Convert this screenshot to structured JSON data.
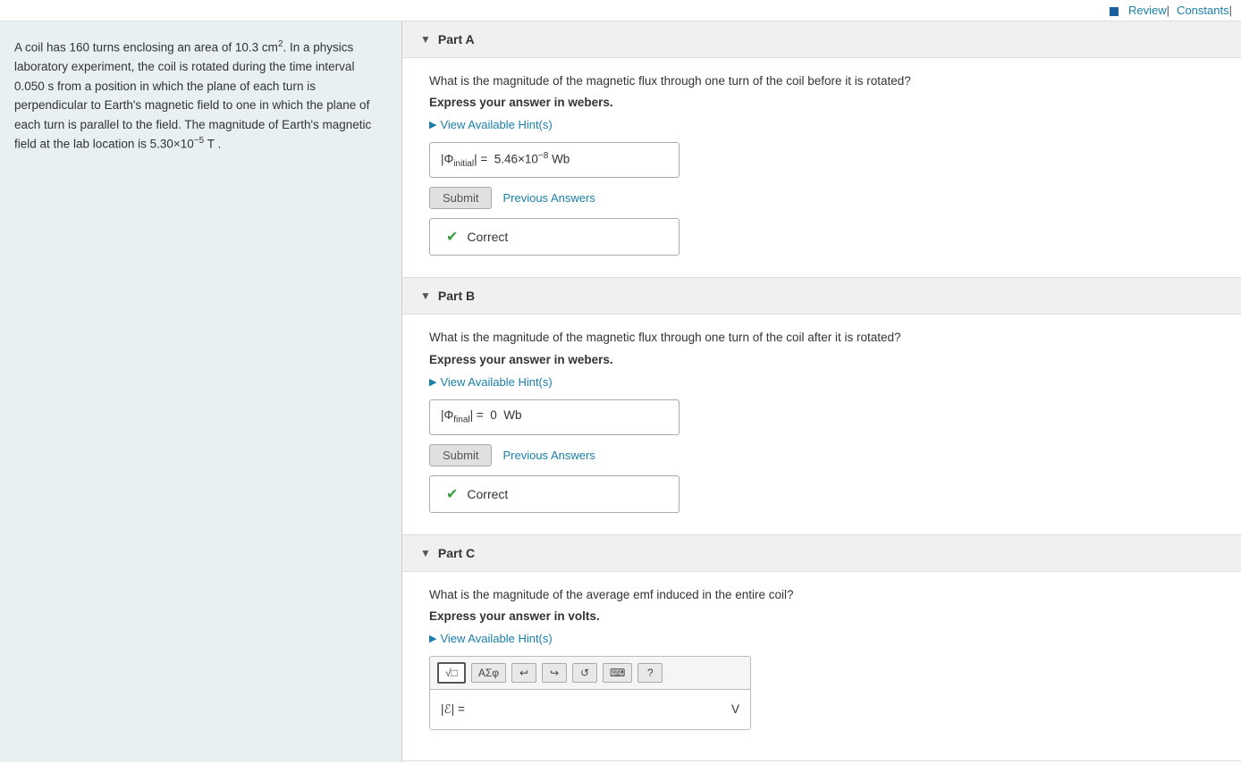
{
  "topbar": {
    "review_label": "Review",
    "constants_label": "Constants",
    "separator": "|"
  },
  "sidebar": {
    "problem_text": "A coil has 160 turns enclosing an area of 10.3 cm",
    "area_exp": "2",
    "problem_text2": ". In a physics laboratory experiment, the coil is rotated during the time interval 0.050 s  from a position in which the plane of each turn is perpendicular to Earth's magnetic field to one in which the plane of each turn is parallel to the field. The magnitude of Earth's magnetic field at the lab location is 5.30×10",
    "field_exp": "−5",
    "field_unit": "T"
  },
  "partA": {
    "label": "Part A",
    "question": "What is the magnitude of the magnetic flux through one turn of the coil before it is rotated?",
    "express": "Express your answer in webers.",
    "hint_label": "View Available Hint(s)",
    "answer_prefix": "|Φ",
    "answer_sub": "initial",
    "answer_suffix": "| =  5.46×10",
    "answer_exp": "−8",
    "answer_unit": " Wb",
    "submit_label": "Submit",
    "prev_answers_label": "Previous Answers",
    "correct_label": "Correct"
  },
  "partB": {
    "label": "Part B",
    "question": "What is the magnitude  of the magnetic flux through one turn of the coil after it is rotated?",
    "express": "Express your answer in webers.",
    "hint_label": "View Available Hint(s)",
    "answer_prefix": "|Φ",
    "answer_sub": "final",
    "answer_suffix": "| =  0",
    "answer_unit": "  Wb",
    "submit_label": "Submit",
    "prev_answers_label": "Previous Answers",
    "correct_label": "Correct"
  },
  "partC": {
    "label": "Part C",
    "question": "What is the magnitude of the average emf induced in the entire coil?",
    "express": "Express your answer in volts.",
    "hint_label": "View Available Hint(s)",
    "toolbar": {
      "btn1": "√□",
      "btn2": "AΣφ",
      "btn3": "↩",
      "btn4": "↪",
      "btn5": "↺",
      "btn6": "⌨",
      "btn7": "?"
    },
    "answer_label": "|ℰ| =",
    "answer_unit": "V"
  }
}
